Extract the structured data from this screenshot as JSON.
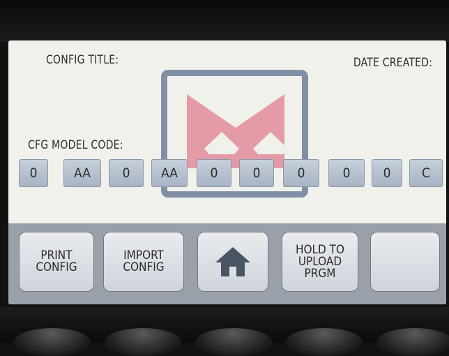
{
  "screen": {
    "config_title_label": "CONFIG TITLE:",
    "date_created_label": "DATE CREATED:",
    "model_code_label": "CFG MODEL CODE:",
    "model_code_fields": [
      "0",
      "AA",
      "0",
      "AA",
      "0",
      "0",
      "0",
      "0",
      "0",
      "C"
    ],
    "logo": {
      "icon": "crown-logo-icon",
      "crown_color": "#e59aa7",
      "frame_color": "#7f8fa5"
    }
  },
  "buttons": {
    "print_config": "PRINT\nCONFIG",
    "import_config": "IMPORT\nCONFIG",
    "home": {
      "icon": "home-icon",
      "color": "#4a5563"
    },
    "hold_to_upload": "HOLD TO\nUPLOAD\nPRGM",
    "blank": ""
  }
}
